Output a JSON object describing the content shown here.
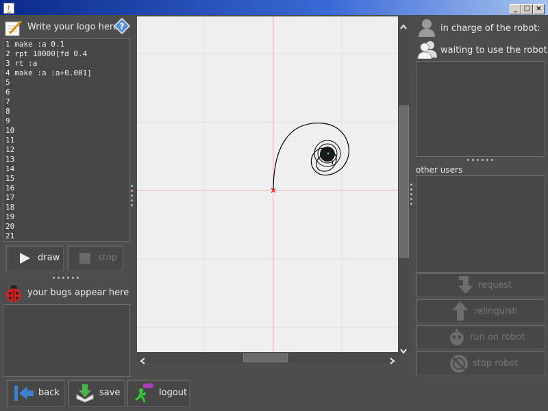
{
  "editor": {
    "title": "Write your logo here",
    "lines": [
      "1 make :a 0.1",
      "2 rpt 10000[fd 0.4",
      "3 rt :a",
      "4 make :a :a+0.001]",
      "5",
      "6",
      "7",
      "8",
      "9",
      "10",
      "11",
      "12",
      "13",
      "14",
      "15",
      "16",
      "17",
      "18",
      "19",
      "20",
      "21"
    ]
  },
  "controls": {
    "draw_label": "draw",
    "stop_label": "stop"
  },
  "bugs": {
    "label": "your bugs appear here"
  },
  "bottom": {
    "back_label": "back",
    "save_label": "save",
    "logout_label": "logout"
  },
  "right": {
    "in_charge_label": "in charge of the robot:",
    "waiting_label": "waiting to use the robot",
    "other_users_label": "other users",
    "request_label": "request",
    "relinquish_label": "relinquish",
    "run_label": "run on robot",
    "stop_robot_label": "stop robot"
  },
  "colors": {
    "background": "#4d4d4d",
    "canvas": "#efefef",
    "grid": "#e0e0e0",
    "axis": "#f0b0b0",
    "turtle": "#ff0000"
  },
  "icons": {
    "help": "help-icon",
    "notepad": "notepad-icon",
    "ladybug": "ladybug-icon"
  }
}
